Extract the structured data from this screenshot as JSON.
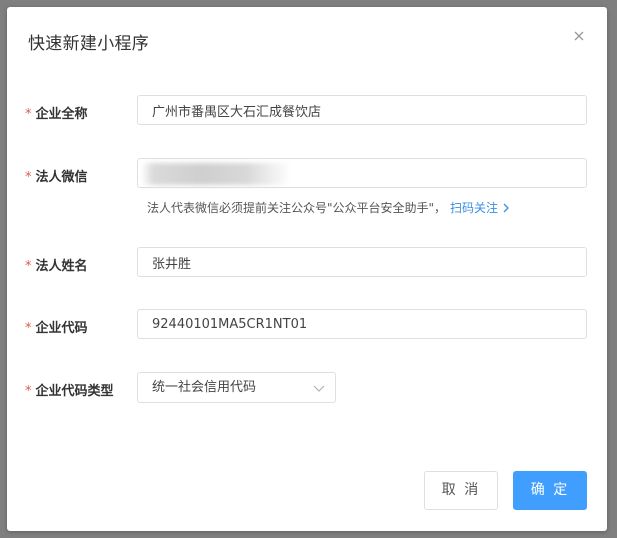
{
  "dialog": {
    "title": "快速新建小程序",
    "close_icon": "close-icon"
  },
  "form": {
    "required_mark": "*",
    "company_name": {
      "label": "企业全称",
      "value": "广州市番禺区大石汇成餐饮店"
    },
    "legal_wechat": {
      "label": "法人微信",
      "value": "",
      "hint_text": "法人代表微信必须提前关注公众号\"公众平台安全助手\"，",
      "hint_link": "扫码关注"
    },
    "legal_name": {
      "label": "法人姓名",
      "value": "张井胜"
    },
    "company_code": {
      "label": "企业代码",
      "value": "92440101MA5CR1NT01"
    },
    "code_type": {
      "label": "企业代码类型",
      "selected": "统一社会信用代码"
    }
  },
  "buttons": {
    "cancel": "取 消",
    "confirm": "确 定"
  },
  "colors": {
    "primary": "#409eff",
    "required": "#e05a4e",
    "link": "#3a8ee6"
  }
}
